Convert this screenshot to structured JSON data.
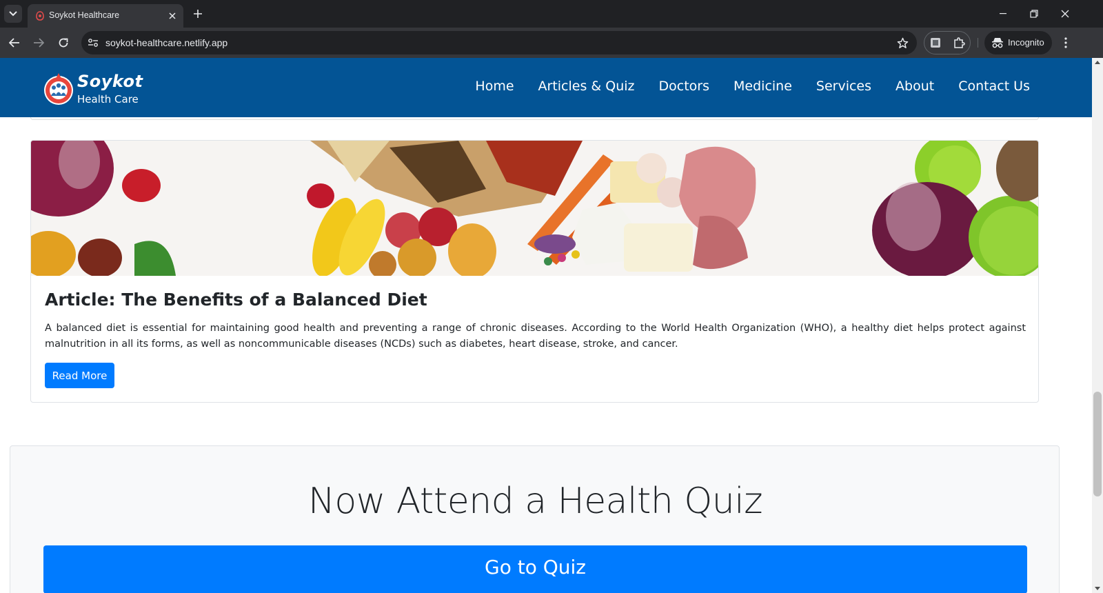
{
  "browser": {
    "tab": {
      "title": "Soykot Healthcare",
      "favicon": "red-cross-favicon"
    },
    "url": "soykot-healthcare.netlify.app",
    "incognito_label": "Incognito",
    "icons": [
      "tab-list-icon",
      "close-icon",
      "plus-icon",
      "minimize-icon",
      "restore-icon",
      "close-window-icon",
      "back-arrow-icon",
      "forward-arrow-icon",
      "reload-icon",
      "site-info-icon",
      "star-icon",
      "extension-icon",
      "puzzle-icon",
      "incognito-icon",
      "more-vert-icon"
    ]
  },
  "site": {
    "logo": {
      "title": "Soykot",
      "subtitle": "Health Care"
    },
    "nav": [
      "Home",
      "Articles & Quiz",
      "Doctors",
      "Medicine",
      "Services",
      "About",
      "Contact Us"
    ]
  },
  "article": {
    "title": "Article: The Benefits of a Balanced Diet",
    "body": "A balanced diet is essential for maintaining good health and preventing a range of chronic diseases. According to the World Health Organization (WHO), a healthy diet helps protect against malnutrition in all its forms, as well as noncommunicable diseases (NCDs) such as diabetes, heart disease, stroke, and cancer.",
    "button": "Read More"
  },
  "quiz": {
    "heading": "Now Attend a Health Quiz",
    "button": "Go to Quiz"
  },
  "colors": {
    "navbar": "#035495",
    "primary_button": "#007bff",
    "quiz_background": "#f8f9fa",
    "chrome_dark": "#202124",
    "chrome_toolbar": "#35363a"
  }
}
